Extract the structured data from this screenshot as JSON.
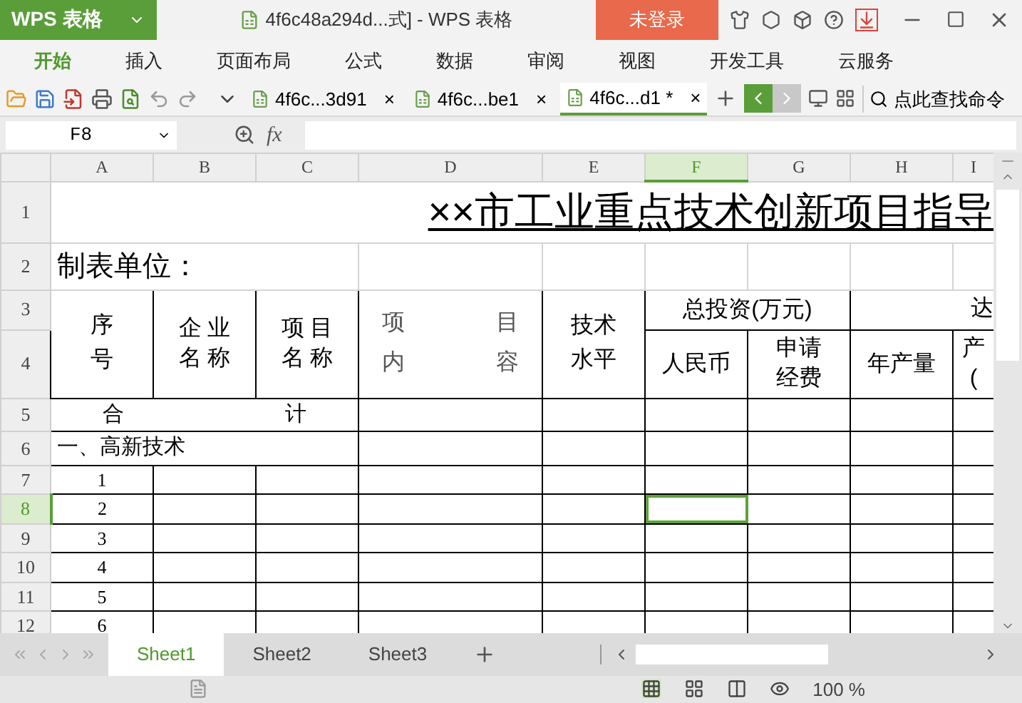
{
  "app": {
    "name": "WPS 表格",
    "title": "4f6c48a294d...式] - WPS 表格",
    "login": "未登录"
  },
  "menu": [
    {
      "label": "开始",
      "selected": true
    },
    {
      "label": "插入",
      "selected": false
    },
    {
      "label": "页面布局",
      "selected": false
    },
    {
      "label": "公式",
      "selected": false
    },
    {
      "label": "数据",
      "selected": false
    },
    {
      "label": "审阅",
      "selected": false
    },
    {
      "label": "视图",
      "selected": false
    },
    {
      "label": "开发工具",
      "selected": false
    },
    {
      "label": "云服务",
      "selected": false
    }
  ],
  "doc_tabs": [
    {
      "label": "4f6c...3d91",
      "close": "×",
      "selected": false
    },
    {
      "label": "4f6c...be1",
      "close": "×",
      "selected": false
    },
    {
      "label": "4f6c...d1 *",
      "close": "×",
      "selected": true
    }
  ],
  "search": {
    "placeholder": "点此查找命令"
  },
  "formula_bar": {
    "name_box": "F8",
    "fx": "fx"
  },
  "columns": [
    {
      "label": "A",
      "selected": false
    },
    {
      "label": "B",
      "selected": false
    },
    {
      "label": "C",
      "selected": false
    },
    {
      "label": "D",
      "selected": false
    },
    {
      "label": "E",
      "selected": false
    },
    {
      "label": "F",
      "selected": true
    },
    {
      "label": "G",
      "selected": false
    },
    {
      "label": "H",
      "selected": false
    },
    {
      "label": "I",
      "selected": false
    }
  ],
  "rows": [
    {
      "number": "1",
      "selected": false,
      "cells": [
        {
          "kind": "title",
          "lines": [
            "××市工业重点技术创新项目指导"
          ],
          "colspan": 9
        }
      ]
    },
    {
      "number": "2",
      "selected": false,
      "cells": [
        {
          "kind": "left",
          "lines": [
            "制表单位："
          ],
          "colspan": 3
        },
        {
          "kind": "empty"
        },
        {
          "kind": "empty"
        },
        {
          "kind": "empty"
        },
        {
          "kind": "empty"
        },
        {
          "kind": "empty"
        },
        {
          "kind": "empty"
        }
      ]
    },
    {
      "number": "3",
      "selected": false,
      "cells": [
        {
          "kind": "vspread",
          "lines": [
            "序",
            "号"
          ],
          "rowspan": 2
        },
        {
          "kind": "center",
          "lines": [
            "企 业",
            "名 称"
          ],
          "rowspan": 2
        },
        {
          "kind": "center",
          "lines": [
            "项 目",
            "名 称"
          ],
          "rowspan": 2
        },
        {
          "kind": "hspread",
          "lines": [
            "项",
            "目",
            "内",
            "容"
          ],
          "rowspan": 2
        },
        {
          "kind": "vspread",
          "lines": [
            "技术",
            "水平"
          ],
          "rowspan": 2
        },
        {
          "kind": "center",
          "lines": [
            "总投资(万元)"
          ],
          "colspan": 2
        },
        {
          "kind": "right",
          "lines": [
            "达"
          ],
          "colspan": 2
        }
      ]
    },
    {
      "number": "4",
      "selected": false,
      "cells": [
        {
          "kind": "center",
          "lines": [
            "人民币"
          ]
        },
        {
          "kind": "center",
          "lines": [
            "申请",
            "经费"
          ]
        },
        {
          "kind": "center",
          "lines": [
            "年产量"
          ]
        },
        {
          "kind": "center",
          "lines": [
            "产",
            "("
          ]
        }
      ]
    },
    {
      "number": "5",
      "selected": false,
      "cells": [
        {
          "kind": "hpair",
          "lines": [
            "合",
            "计"
          ],
          "colspan": 3
        },
        {
          "kind": "empty"
        },
        {
          "kind": "empty"
        },
        {
          "kind": "empty"
        },
        {
          "kind": "empty"
        },
        {
          "kind": "empty"
        },
        {
          "kind": "empty"
        }
      ]
    },
    {
      "number": "6",
      "selected": false,
      "cells": [
        {
          "kind": "left",
          "lines": [
            "一、高新技术"
          ],
          "colspan": 3
        },
        {
          "kind": "empty"
        },
        {
          "kind": "empty"
        },
        {
          "kind": "empty"
        },
        {
          "kind": "empty"
        },
        {
          "kind": "empty"
        },
        {
          "kind": "empty"
        }
      ]
    },
    {
      "number": "7",
      "selected": false,
      "cells": [
        {
          "kind": "number",
          "lines": [
            "1"
          ]
        },
        {
          "kind": "empty"
        },
        {
          "kind": "empty"
        },
        {
          "kind": "empty"
        },
        {
          "kind": "empty"
        },
        {
          "kind": "empty"
        },
        {
          "kind": "empty"
        },
        {
          "kind": "empty"
        },
        {
          "kind": "empty"
        }
      ]
    },
    {
      "number": "8",
      "selected": true,
      "cells": [
        {
          "kind": "number",
          "lines": [
            "2"
          ]
        },
        {
          "kind": "empty"
        },
        {
          "kind": "empty"
        },
        {
          "kind": "empty"
        },
        {
          "kind": "empty"
        },
        {
          "kind": "empty"
        },
        {
          "kind": "empty"
        },
        {
          "kind": "empty"
        },
        {
          "kind": "empty"
        }
      ]
    },
    {
      "number": "9",
      "selected": false,
      "cells": [
        {
          "kind": "number",
          "lines": [
            "3"
          ]
        },
        {
          "kind": "empty"
        },
        {
          "kind": "empty"
        },
        {
          "kind": "empty"
        },
        {
          "kind": "empty"
        },
        {
          "kind": "empty"
        },
        {
          "kind": "empty"
        },
        {
          "kind": "empty"
        },
        {
          "kind": "empty"
        }
      ]
    },
    {
      "number": "10",
      "selected": false,
      "cells": [
        {
          "kind": "number",
          "lines": [
            "4"
          ]
        },
        {
          "kind": "empty"
        },
        {
          "kind": "empty"
        },
        {
          "kind": "empty"
        },
        {
          "kind": "empty"
        },
        {
          "kind": "empty"
        },
        {
          "kind": "empty"
        },
        {
          "kind": "empty"
        },
        {
          "kind": "empty"
        }
      ]
    },
    {
      "number": "11",
      "selected": false,
      "cells": [
        {
          "kind": "number",
          "lines": [
            "5"
          ]
        },
        {
          "kind": "empty"
        },
        {
          "kind": "empty"
        },
        {
          "kind": "empty"
        },
        {
          "kind": "empty"
        },
        {
          "kind": "empty"
        },
        {
          "kind": "empty"
        },
        {
          "kind": "empty"
        },
        {
          "kind": "empty"
        }
      ]
    },
    {
      "number": "12",
      "selected": false,
      "cells": [
        {
          "kind": "number",
          "lines": [
            "6"
          ]
        },
        {
          "kind": "empty"
        },
        {
          "kind": "empty"
        },
        {
          "kind": "empty"
        },
        {
          "kind": "empty"
        },
        {
          "kind": "empty"
        },
        {
          "kind": "empty"
        },
        {
          "kind": "empty"
        },
        {
          "kind": "empty"
        }
      ]
    }
  ],
  "sheet_tabs": [
    {
      "label": "Sheet1",
      "selected": true
    },
    {
      "label": "Sheet2",
      "selected": false
    },
    {
      "label": "Sheet3",
      "selected": false
    }
  ],
  "status_bar": {
    "zoom": "100 %"
  }
}
